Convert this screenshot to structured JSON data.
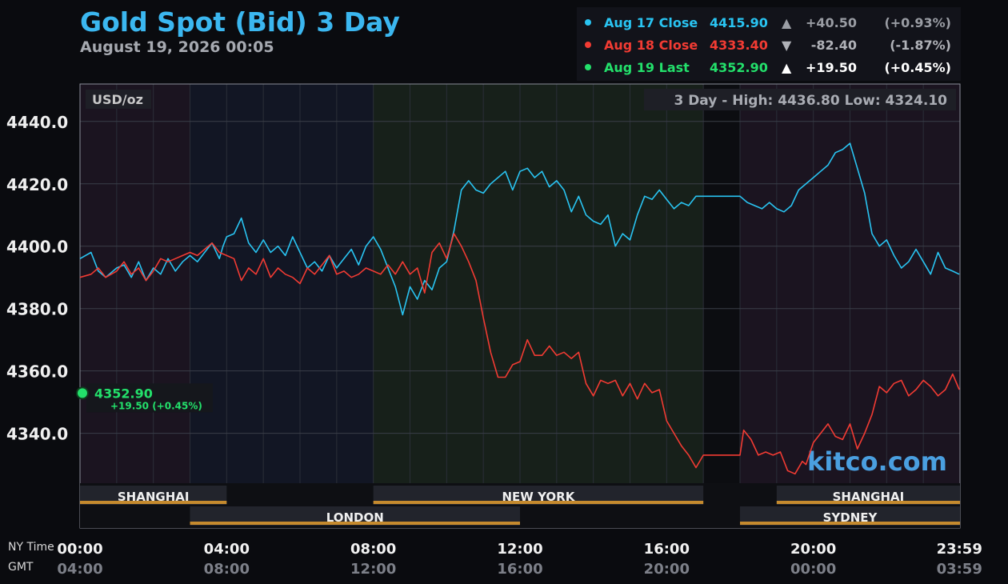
{
  "header": {
    "title": "Gold Spot (Bid) 3 Day",
    "subtitle": "August 19, 2026 00:05"
  },
  "legend": [
    {
      "label": "Aug 17 Close",
      "value": "4415.90",
      "arrow": "▲",
      "change": "+40.50",
      "pct": "(+0.93%)",
      "color": "#29c4f2",
      "text_color": "#29c4f2",
      "change_color": "#9a9da4"
    },
    {
      "label": "Aug 18 Close",
      "value": "4333.40",
      "arrow": "▼",
      "change": "-82.40",
      "pct": "(-1.87%)",
      "color": "#f23b33",
      "text_color": "#f23b33",
      "change_color": "#b0b2b8"
    },
    {
      "label": "Aug 19 Last",
      "value": "4352.90",
      "arrow": "▲",
      "change": "+19.50",
      "pct": "(+0.45%)",
      "color": "#23e06b",
      "text_color": "#23e06b",
      "change_color": "#ffffff"
    }
  ],
  "chart_data": {
    "type": "line",
    "unit_label": "USD/oz",
    "range_label": "3 Day - High: 4436.80  Low: 4324.10",
    "ylim": [
      4324,
      4452
    ],
    "y_ticks": [
      4440,
      4420,
      4400,
      4380,
      4360,
      4340
    ],
    "y_tick_labels": [
      "4440.0",
      "4420.0",
      "4400.0",
      "4380.0",
      "4360.0",
      "4340.0"
    ],
    "xlim": [
      0,
      24
    ],
    "x_ticks": [
      0,
      4,
      8,
      12,
      16,
      20,
      23.983
    ],
    "x_tick_labels_ny": [
      "00:00",
      "04:00",
      "08:00",
      "12:00",
      "16:00",
      "20:00",
      "23:59"
    ],
    "x_tick_labels_gmt": [
      "04:00",
      "08:00",
      "12:00",
      "16:00",
      "20:00",
      "00:00",
      "03:59"
    ],
    "row_labels": {
      "ny": "NY Time",
      "gmt": "GMT"
    },
    "grid": true,
    "series": [
      {
        "name": "Aug 17 Close",
        "color": "#29c4f2",
        "x": [
          0,
          0.3,
          0.5,
          0.7,
          1.0,
          1.2,
          1.4,
          1.6,
          1.8,
          2.0,
          2.2,
          2.4,
          2.6,
          2.8,
          3.0,
          3.2,
          3.4,
          3.6,
          3.8,
          3.9,
          4.0,
          4.2,
          4.4,
          4.6,
          4.8,
          5.0,
          5.2,
          5.4,
          5.6,
          5.8,
          6.0,
          6.2,
          6.4,
          6.6,
          6.8,
          7.0,
          7.2,
          7.4,
          7.6,
          7.8,
          8.0,
          8.2,
          8.4,
          8.6,
          8.8,
          9.0,
          9.2,
          9.4,
          9.6,
          9.8,
          10.0,
          10.2,
          10.4,
          10.6,
          10.8,
          11.0,
          11.2,
          11.4,
          11.6,
          11.8,
          12.0,
          12.2,
          12.4,
          12.6,
          12.8,
          13.0,
          13.2,
          13.4,
          13.6,
          13.8,
          14.0,
          14.2,
          14.4,
          14.6,
          14.8,
          15.0,
          15.2,
          15.4,
          15.6,
          15.8,
          16.0,
          16.2,
          16.4,
          16.6,
          16.8,
          17.0,
          17.2,
          17.5,
          18.0,
          18.2,
          18.4,
          18.6,
          18.8,
          19.0,
          19.2,
          19.4,
          19.6,
          19.8,
          20.0,
          20.2,
          20.4,
          20.6,
          20.8,
          21.0,
          21.2,
          21.4,
          21.6,
          21.8,
          22.0,
          22.2,
          22.4,
          22.6,
          22.8,
          23.0,
          23.2,
          23.4,
          23.6,
          23.8,
          23.98
        ],
        "y": [
          4396,
          4398,
          4392,
          4390,
          4393,
          4394,
          4390,
          4395,
          4389,
          4393,
          4391,
          4396,
          4392,
          4395,
          4397,
          4395,
          4398,
          4401,
          4396,
          4400,
          4403,
          4404,
          4409,
          4401,
          4398,
          4402,
          4398,
          4400,
          4397,
          4403,
          4398,
          4393,
          4395,
          4392,
          4397,
          4393,
          4396,
          4399,
          4394,
          4400,
          4403,
          4399,
          4393,
          4387,
          4378,
          4387,
          4383,
          4389,
          4386,
          4393,
          4395,
          4405,
          4418,
          4421,
          4418,
          4417,
          4420,
          4422,
          4424,
          4418,
          4424,
          4425,
          4422,
          4424,
          4419,
          4421,
          4418,
          4411,
          4416,
          4410,
          4408,
          4407,
          4410,
          4400,
          4404,
          4402,
          4410,
          4416,
          4415,
          4418,
          4415,
          4412,
          4414,
          4413,
          4416,
          4416,
          4416,
          4416,
          4416,
          4414,
          4413,
          4412,
          4414,
          4412,
          4411,
          4413,
          4418,
          4420,
          4422,
          4424,
          4426,
          4430,
          4431,
          4433,
          4425,
          4417,
          4404,
          4400,
          4402,
          4397,
          4393,
          4395,
          4399,
          4395,
          4391,
          4398,
          4393,
          4392,
          4391
        ]
      },
      {
        "name": "Aug 18 Close",
        "color": "#f23b33",
        "x": [
          0,
          0.3,
          0.5,
          0.7,
          1.0,
          1.2,
          1.4,
          1.6,
          1.8,
          2.0,
          2.2,
          2.4,
          2.6,
          2.8,
          3.0,
          3.2,
          3.4,
          3.6,
          3.8,
          4.0,
          4.2,
          4.4,
          4.6,
          4.8,
          5.0,
          5.2,
          5.4,
          5.6,
          5.8,
          6.0,
          6.2,
          6.4,
          6.6,
          6.8,
          7.0,
          7.2,
          7.4,
          7.6,
          7.8,
          8.0,
          8.2,
          8.4,
          8.6,
          8.8,
          9.0,
          9.2,
          9.4,
          9.6,
          9.8,
          10.0,
          10.2,
          10.4,
          10.6,
          10.8,
          11.0,
          11.2,
          11.4,
          11.6,
          11.8,
          12.0,
          12.2,
          12.4,
          12.6,
          12.8,
          13.0,
          13.2,
          13.4,
          13.6,
          13.8,
          14.0,
          14.2,
          14.4,
          14.6,
          14.8,
          15.0,
          15.2,
          15.4,
          15.6,
          15.8,
          16.0,
          16.2,
          16.4,
          16.6,
          16.8,
          17.0,
          17.2,
          17.5,
          18.0,
          18.1,
          18.3,
          18.5,
          18.7,
          18.9,
          19.1,
          19.3,
          19.5,
          19.7,
          19.8,
          20.0,
          20.2,
          20.4,
          20.6,
          20.8,
          21.0,
          21.2,
          21.4,
          21.6,
          21.8,
          22.0,
          22.2,
          22.4,
          22.6,
          22.8,
          23.0,
          23.2,
          23.4,
          23.6,
          23.8,
          23.98
        ],
        "y": [
          4390,
          4391,
          4393,
          4390,
          4392,
          4395,
          4391,
          4393,
          4389,
          4392,
          4396,
          4395,
          4396,
          4397,
          4398,
          4397,
          4399,
          4401,
          4398,
          4397,
          4396,
          4389,
          4393,
          4391,
          4396,
          4390,
          4393,
          4391,
          4390,
          4388,
          4393,
          4391,
          4394,
          4397,
          4391,
          4392,
          4390,
          4391,
          4393,
          4392,
          4391,
          4394,
          4391,
          4395,
          4391,
          4393,
          4385,
          4398,
          4401,
          4396,
          4404,
          4400,
          4395,
          4389,
          4377,
          4366,
          4358,
          4358,
          4362,
          4363,
          4370,
          4365,
          4365,
          4368,
          4365,
          4366,
          4364,
          4366,
          4356,
          4352,
          4357,
          4356,
          4357,
          4352,
          4356,
          4351,
          4356,
          4353,
          4354,
          4344,
          4340,
          4336,
          4333,
          4329,
          4333,
          4333,
          4333,
          4333,
          4341,
          4338,
          4333,
          4334,
          4333,
          4334,
          4328,
          4327,
          4331,
          4330,
          4337,
          4340,
          4343,
          4339,
          4338,
          4343,
          4335,
          4340,
          4346,
          4355,
          4353,
          4356,
          4357,
          4352,
          4354,
          4357,
          4355,
          4352,
          4354,
          4359,
          4354
        ]
      }
    ],
    "last_marker": {
      "value_label": "4352.90",
      "change_label": "+19.50 (+0.45%)",
      "y": 4352.9
    },
    "sessions": [
      {
        "name": "SHANGHAI",
        "start": 0,
        "end": 4,
        "row": 1
      },
      {
        "name": "NEW YORK",
        "start": 8,
        "end": 17,
        "row": 1
      },
      {
        "name": "SHANGHAI",
        "start": 19,
        "end": 24,
        "row": 1
      },
      {
        "name": "LONDON",
        "start": 3,
        "end": 12,
        "row": 2
      },
      {
        "name": "SYDNEY",
        "start": 18,
        "end": 24,
        "row": 2
      }
    ],
    "session_bg": [
      {
        "start": 0,
        "end": 3,
        "color": "#1b1420"
      },
      {
        "start": 3,
        "end": 8,
        "color": "#121624"
      },
      {
        "start": 8,
        "end": 17,
        "color": "#17201a"
      },
      {
        "start": 17,
        "end": 18,
        "color": "#0c0d11"
      },
      {
        "start": 18,
        "end": 19,
        "color": "#1b1420"
      },
      {
        "start": 19,
        "end": 24,
        "color": "#1b1420"
      }
    ],
    "watermark": "kitco.com"
  }
}
